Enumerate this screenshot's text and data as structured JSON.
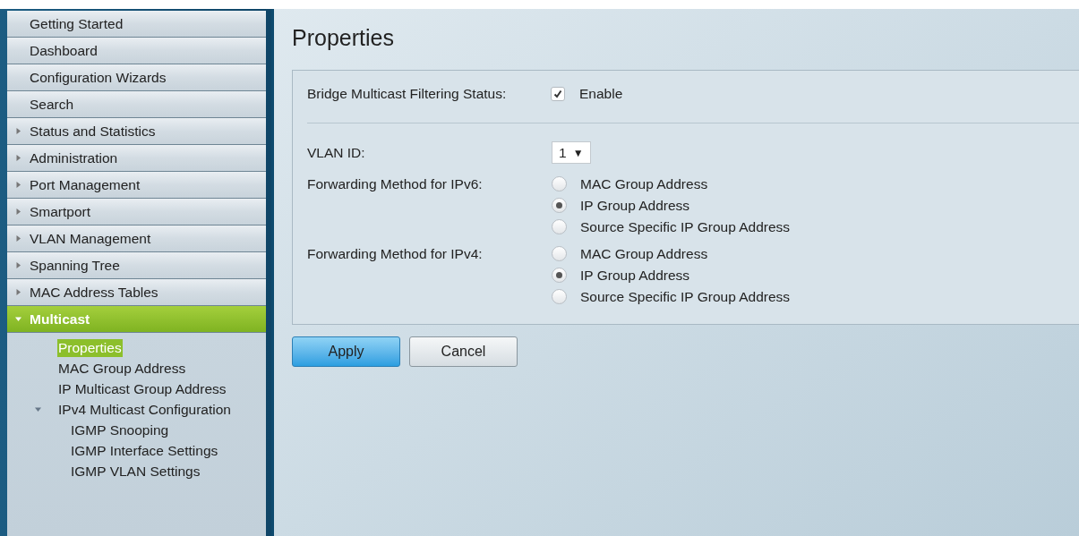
{
  "sidebar": {
    "items": [
      {
        "label": "Getting Started",
        "kind": "page",
        "selected": false
      },
      {
        "label": "Dashboard",
        "kind": "page",
        "selected": false
      },
      {
        "label": "Configuration Wizards",
        "kind": "page",
        "selected": false
      },
      {
        "label": "Search",
        "kind": "page",
        "selected": false
      },
      {
        "label": "Status and Statistics",
        "kind": "folder",
        "expanded": false,
        "selected": false
      },
      {
        "label": "Administration",
        "kind": "folder",
        "expanded": false,
        "selected": false
      },
      {
        "label": "Port Management",
        "kind": "folder",
        "expanded": false,
        "selected": false
      },
      {
        "label": "Smartport",
        "kind": "folder",
        "expanded": false,
        "selected": false
      },
      {
        "label": "VLAN Management",
        "kind": "folder",
        "expanded": false,
        "selected": false
      },
      {
        "label": "Spanning Tree",
        "kind": "folder",
        "expanded": false,
        "selected": false
      },
      {
        "label": "MAC Address Tables",
        "kind": "folder",
        "expanded": false,
        "selected": false
      },
      {
        "label": "Multicast",
        "kind": "folder",
        "expanded": true,
        "selected": true,
        "children": [
          {
            "label": "Properties",
            "kind": "page",
            "selected": true
          },
          {
            "label": "MAC Group Address",
            "kind": "page",
            "selected": false
          },
          {
            "label": "IP Multicast Group Address",
            "kind": "page",
            "selected": false
          },
          {
            "label": "IPv4 Multicast Configuration",
            "kind": "folder",
            "expanded": true,
            "selected": false,
            "children": [
              {
                "label": "IGMP Snooping",
                "kind": "page",
                "selected": false
              },
              {
                "label": "IGMP Interface Settings",
                "kind": "page",
                "selected": false
              },
              {
                "label": "IGMP VLAN Settings",
                "kind": "page",
                "selected": false
              }
            ]
          }
        ]
      }
    ]
  },
  "page": {
    "title": "Properties",
    "filtering": {
      "label": "Bridge Multicast Filtering Status:",
      "checked": true,
      "option": "Enable"
    },
    "vlan": {
      "label": "VLAN ID:",
      "value": "1",
      "caret": "▼"
    },
    "forwarding": [
      {
        "label": "Forwarding Method for IPv6:",
        "options": [
          {
            "label": "MAC Group Address",
            "selected": false
          },
          {
            "label": "IP Group Address",
            "selected": true
          },
          {
            "label": "Source Specific IP Group Address",
            "selected": false
          }
        ]
      },
      {
        "label": "Forwarding Method for IPv4:",
        "options": [
          {
            "label": "MAC Group Address",
            "selected": false
          },
          {
            "label": "IP Group Address",
            "selected": true
          },
          {
            "label": "Source Specific IP Group Address",
            "selected": false
          }
        ]
      }
    ],
    "buttons": [
      {
        "label": "Apply",
        "kind": "primary"
      },
      {
        "label": "Cancel",
        "kind": "secondary"
      }
    ]
  }
}
